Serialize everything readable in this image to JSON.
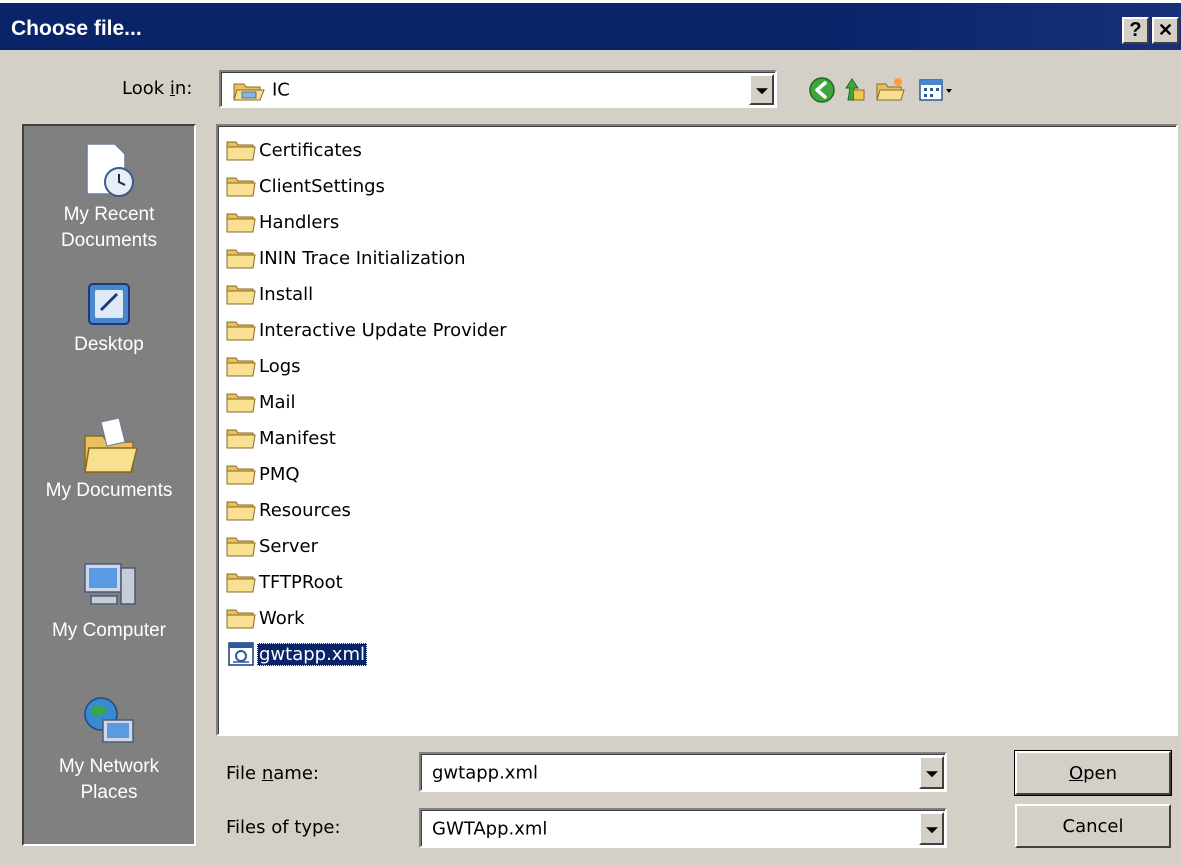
{
  "window": {
    "title": "Choose file...",
    "help_glyph": "?",
    "close_glyph": "✕"
  },
  "look_in": {
    "label_pre": "Look ",
    "label_mnemonic": "i",
    "label_post": "n:",
    "value": "IC"
  },
  "toolbar": {
    "icons": [
      "back-icon",
      "up-one-level-icon",
      "new-folder-icon",
      "view-menu-icon"
    ]
  },
  "places": [
    {
      "label_line1": "My Recent",
      "label_line2": "Documents",
      "icon": "recent-documents-icon"
    },
    {
      "label_line1": "Desktop",
      "label_line2": "",
      "icon": "desktop-icon"
    },
    {
      "label_line1": "My Documents",
      "label_line2": "",
      "icon": "my-documents-icon"
    },
    {
      "label_line1": "My Computer",
      "label_line2": "",
      "icon": "my-computer-icon"
    },
    {
      "label_line1": "My Network",
      "label_line2": "Places",
      "icon": "network-places-icon"
    }
  ],
  "files": [
    {
      "name": "Certificates",
      "type": "folder"
    },
    {
      "name": "ClientSettings",
      "type": "folder"
    },
    {
      "name": "Handlers",
      "type": "folder"
    },
    {
      "name": "ININ Trace Initialization",
      "type": "folder"
    },
    {
      "name": "Install",
      "type": "folder"
    },
    {
      "name": "Interactive Update Provider",
      "type": "folder"
    },
    {
      "name": "Logs",
      "type": "folder"
    },
    {
      "name": "Mail",
      "type": "folder"
    },
    {
      "name": "Manifest",
      "type": "folder"
    },
    {
      "name": "PMQ",
      "type": "folder"
    },
    {
      "name": "Resources",
      "type": "folder"
    },
    {
      "name": "Server",
      "type": "folder"
    },
    {
      "name": "TFTPRoot",
      "type": "folder"
    },
    {
      "name": "Work",
      "type": "folder"
    },
    {
      "name": "gwtapp.xml",
      "type": "xml-file",
      "selected": true
    }
  ],
  "file_name": {
    "label_pre": "File ",
    "label_mnemonic": "n",
    "label_post": "ame:",
    "value": "gwtapp.xml"
  },
  "file_type": {
    "label": "Files of type:",
    "value": "GWTApp.xml"
  },
  "buttons": {
    "open_mnemonic": "O",
    "open_rest": "pen",
    "cancel": "Cancel"
  }
}
